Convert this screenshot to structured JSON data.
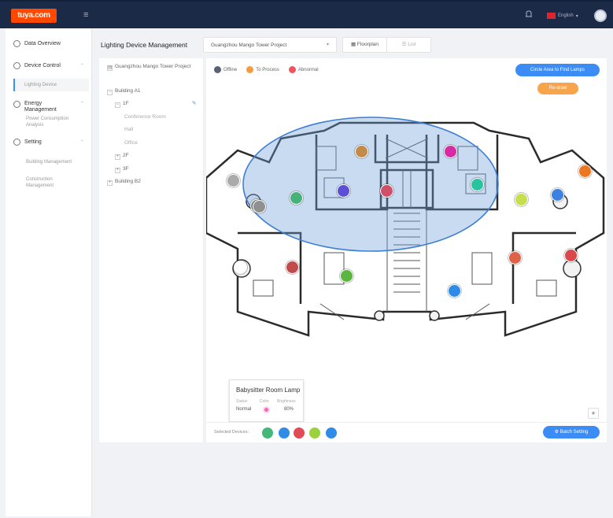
{
  "topbar": {
    "logo": "tuya.com",
    "language": "English",
    "icons": [
      "menu-icon",
      "bell-icon",
      "flag-icon",
      "avatar"
    ]
  },
  "sidebar": {
    "items": [
      {
        "label": "Data Overview",
        "icon": "dashboard-icon"
      },
      {
        "label": "Device Control",
        "icon": "device-icon",
        "sub": [
          "Lighting Device"
        ]
      },
      {
        "label": "Energy Management",
        "icon": "energy-icon",
        "sub": [
          "Power Consumption Analysis"
        ]
      },
      {
        "label": "Setting",
        "icon": "gear-icon",
        "sub": [
          "Building Management",
          "Construction Management"
        ]
      }
    ]
  },
  "header": {
    "title": "Lighting Device Management",
    "project": "Guangzhou Mango Tower Project",
    "views": [
      "Floorplan",
      "List"
    ]
  },
  "tree": {
    "root": "Guangzhou Mango Tower Project",
    "nodes": [
      "Building A1",
      "1F",
      "Conference Room",
      "Hall",
      "Office",
      "2F",
      "3F",
      "Building B2"
    ]
  },
  "legend": [
    {
      "label": "Offline",
      "color": "#5a6170"
    },
    {
      "label": "To Process",
      "color": "#f59c3c"
    },
    {
      "label": "Abnormal",
      "color": "#f0545f"
    }
  ],
  "buttons": {
    "circle": "Circle Area to Find Lamps",
    "reset": "Re-draw",
    "batch": "Batch Setting",
    "zoom": "+"
  },
  "tooltip": {
    "title": "Babysitter Room Lamp",
    "headers": [
      "Status",
      "Color",
      "Brightness"
    ],
    "status": "Normal",
    "brightness": "80%"
  },
  "selected": {
    "label": "Selected Devices:",
    "colors": [
      "#43b879",
      "#2f8be6",
      "#e24b55",
      "#9ad13c",
      "#2f8be6"
    ]
  },
  "lamps": [
    {
      "color": "#c38b4a"
    },
    {
      "color": "#d82aa7"
    },
    {
      "color": "#aaaaaa"
    },
    {
      "color": "#5a4fd6"
    },
    {
      "color": "#d04f6b"
    },
    {
      "color": "#2ac3a0"
    },
    {
      "color": "#46b27a"
    },
    {
      "color": "#909090"
    },
    {
      "color": "#909090"
    },
    {
      "color": "#ee7722"
    },
    {
      "color": "#3d82e0"
    },
    {
      "color": "#c6df4b"
    },
    {
      "color": "#ffffff"
    },
    {
      "color": "#c14a4a"
    },
    {
      "color": "#5ab63e"
    },
    {
      "color": "#e06246"
    },
    {
      "color": "#d9484a"
    },
    {
      "color": "#2f8be6"
    }
  ]
}
